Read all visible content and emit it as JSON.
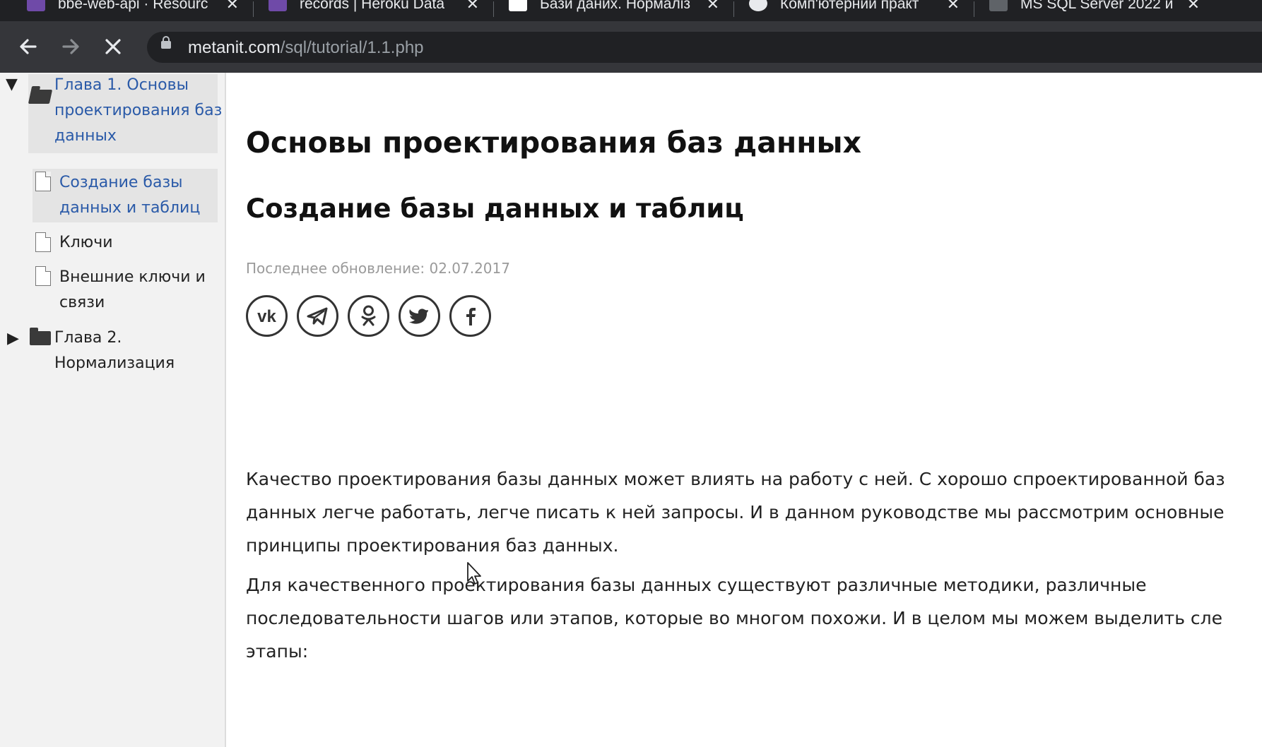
{
  "browser": {
    "tabs": [
      {
        "title": "bbe-web-api · Resourc",
        "favicon_color": "#6f4aa8",
        "close": "✕"
      },
      {
        "title": "records | Heroku Data",
        "favicon_color": "#6f4aa8",
        "close": "✕"
      },
      {
        "title": "Бази даних. Нормаліз",
        "favicon_color": "#ffffff",
        "close": "✕"
      },
      {
        "title": "Комп'ютерний практ",
        "favicon_color": "#e8eaed",
        "close": "✕"
      },
      {
        "title": "MS SQL Server 2022 и",
        "favicon_color": "#5f6368",
        "close": "✕"
      }
    ],
    "back_icon": "arrow-left-icon",
    "forward_icon": "arrow-right-icon",
    "stop_icon": "close-icon",
    "url_host": "metanit.com",
    "url_path": "/sql/tutorial/1.1.php"
  },
  "sidebar": {
    "chapter1": "Глава 1. Основы проектирования баз данных",
    "chapter1_lines": [
      "Глава 1. Основы",
      "проектирования баз",
      "данных"
    ],
    "items": [
      {
        "lines": [
          "Создание базы",
          "данных и таблиц"
        ],
        "active": true
      },
      {
        "lines": [
          "Ключи"
        ],
        "active": false
      },
      {
        "lines": [
          "Внешние ключи и",
          "связи"
        ],
        "active": false
      }
    ],
    "chapter2_lines": [
      "Глава 2.",
      "Нормализация"
    ]
  },
  "main": {
    "h1": "Основы проектирования баз данных",
    "h2": "Создание базы данных и таблиц",
    "updated": "Последнее обновление: 02.07.2017",
    "social": [
      "vk-icon",
      "telegram-icon",
      "odnoklassniki-icon",
      "twitter-icon",
      "facebook-icon"
    ],
    "para1": [
      "Качество проектирования базы данных может влиять на работу с ней. С хорошо спроектированной баз",
      "данных легче работать, легче писать к ней запросы. И в данном руководстве мы рассмотрим основные",
      "принципы проектирования баз данных."
    ],
    "para2": [
      "Для качественного проектирования базы данных существуют различные методики, различные",
      "последовательности шагов или этапов, которые во многом похожи. И в целом мы можем выделить сле",
      "этапы:"
    ]
  }
}
